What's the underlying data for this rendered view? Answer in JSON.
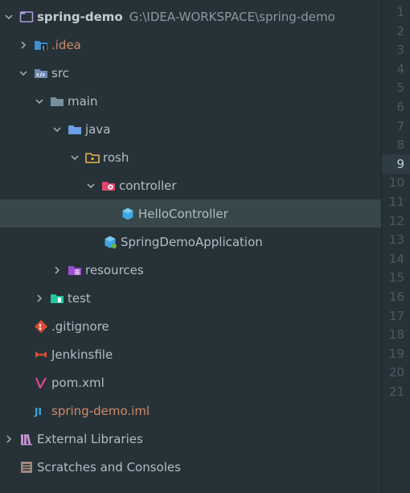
{
  "tree": {
    "project_name": "spring-demo",
    "project_path": "G:\\IDEA-WORKSPACE\\spring-demo",
    "idea": ".idea",
    "src": "src",
    "main": "main",
    "java": "java",
    "rosh": "rosh",
    "controller": "controller",
    "hello_controller": "HelloController",
    "spring_demo_application": "SpringDemoApplication",
    "resources": "resources",
    "test": "test",
    "gitignore": ".gitignore",
    "jenkinsfile": "Jenkinsfile",
    "pom": "pom.xml",
    "iml": "spring-demo.iml",
    "external_libraries": "External Libraries",
    "scratches": "Scratches and Consoles"
  },
  "colors": {
    "background": "#263238",
    "selected_row": "#37474a",
    "iml_text": "#d08a68"
  },
  "gutter": {
    "line_numbers": [
      "1",
      "2",
      "3",
      "4",
      "5",
      "6",
      "7",
      "8",
      "9",
      "10",
      "11",
      "12",
      "13",
      "14",
      "15",
      "16",
      "17",
      "18",
      "19",
      "20",
      "21"
    ],
    "active_line": "9"
  }
}
